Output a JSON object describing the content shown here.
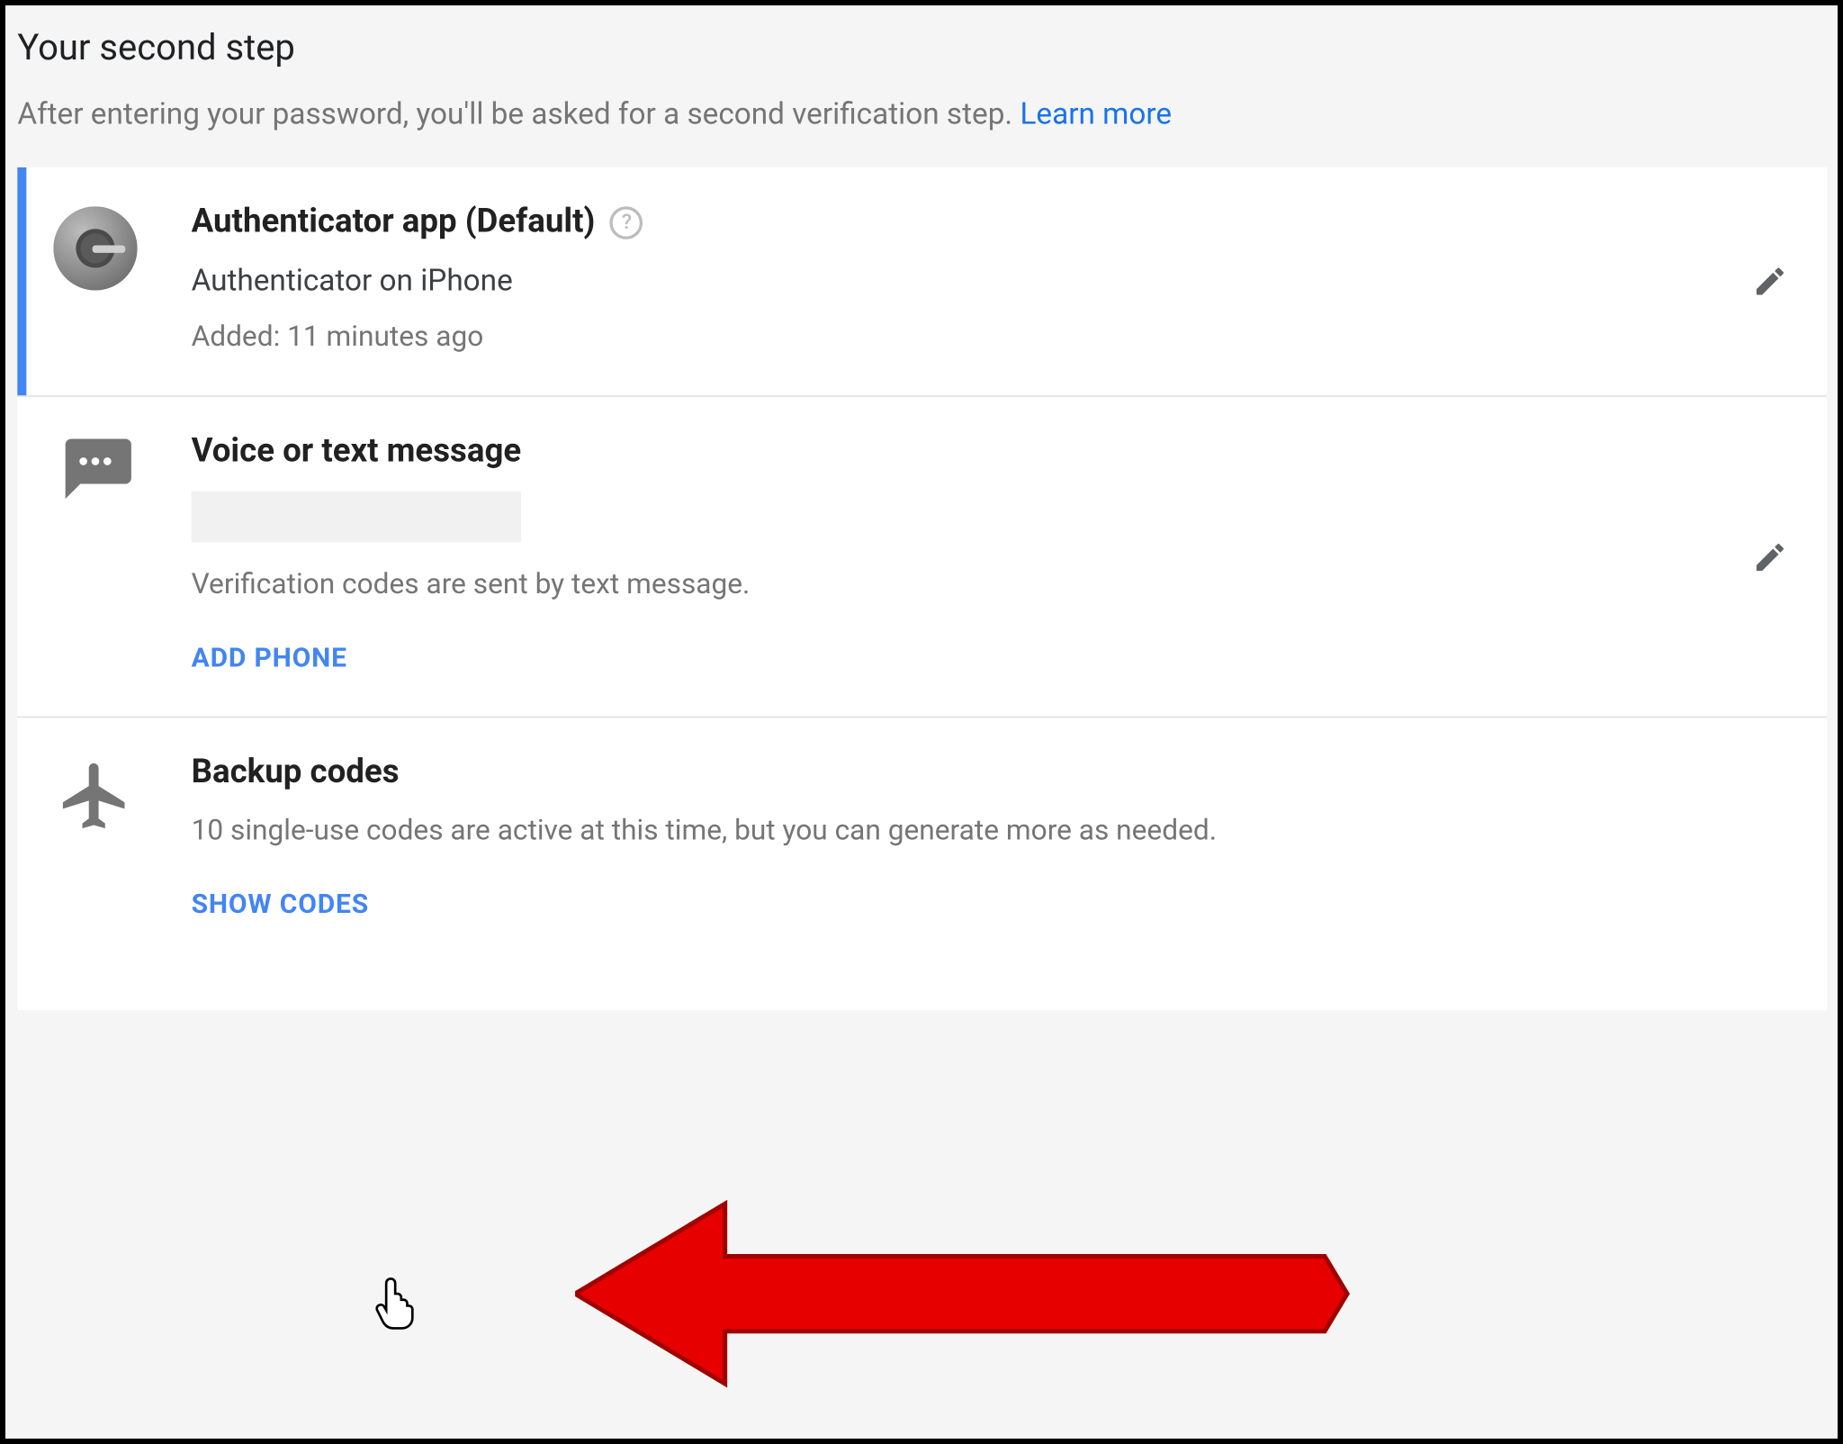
{
  "header": {
    "title": "Your second step",
    "subtitle_before": "After entering your password, you'll be asked for a second verification step. ",
    "learn_more": "Learn more"
  },
  "authenticator": {
    "title": "Authenticator app (Default)",
    "device": "Authenticator on iPhone",
    "added": "Added: 11 minutes ago"
  },
  "sms": {
    "title": "Voice or text message",
    "desc": "Verification codes are sent by text message.",
    "add_phone": "ADD PHONE"
  },
  "backup": {
    "title": "Backup codes",
    "desc": "10 single-use codes are active at this time, but you can generate more as needed.",
    "show_codes": "SHOW CODES"
  },
  "help_glyph": "?"
}
